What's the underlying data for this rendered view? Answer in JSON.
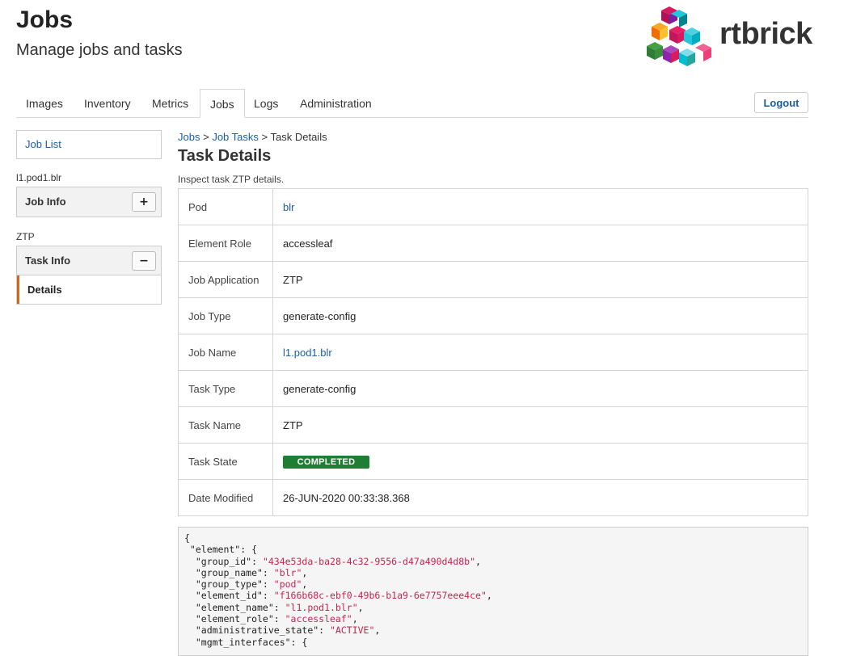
{
  "header": {
    "title": "Jobs",
    "subtitle": "Manage jobs and tasks"
  },
  "logo": {
    "text": "rtbrick"
  },
  "tabs": [
    {
      "label": "Images"
    },
    {
      "label": "Inventory"
    },
    {
      "label": "Metrics"
    },
    {
      "label": "Jobs",
      "active": true
    },
    {
      "label": "Logs"
    },
    {
      "label": "Administration"
    }
  ],
  "logout_label": "Logout",
  "sidebar": {
    "job_list": "Job List",
    "job_label": "l1.pod1.blr",
    "job_info": {
      "title": "Job Info",
      "toggle": "+"
    },
    "task_label": "ZTP",
    "task_info": {
      "title": "Task Info",
      "toggle": "−",
      "items": [
        "Details"
      ]
    }
  },
  "breadcrumb": {
    "jobs": "Jobs",
    "sep": ">",
    "job_tasks": "Job Tasks",
    "current": "Task Details"
  },
  "main": {
    "title": "Task Details",
    "description": "Inspect task ZTP details.",
    "rows": [
      {
        "label": "Pod",
        "value": "blr"
      },
      {
        "label": "Element Role",
        "value": "accessleaf"
      },
      {
        "label": "Job Application",
        "value": "ZTP"
      },
      {
        "label": "Job Type",
        "value": "generate-config"
      },
      {
        "label": "Job Name",
        "value": "l1.pod1.blr"
      },
      {
        "label": "Task Type",
        "value": "generate-config"
      },
      {
        "label": "Task Name",
        "value": "ZTP"
      },
      {
        "label": "Task State",
        "value": "COMPLETED"
      },
      {
        "label": "Date Modified",
        "value": "26-JUN-2020 00:33:38.368"
      }
    ]
  },
  "json_lines": [
    {
      "text": "{"
    },
    {
      "text": " \"element\": {"
    },
    {
      "text": "  \"group_id\": ",
      "str": "\"434e53da-ba28-4c32-9556-d47a490d4d8b\"",
      "after": ","
    },
    {
      "text": "  \"group_name\": ",
      "str": "\"blr\"",
      "after": ","
    },
    {
      "text": "  \"group_type\": ",
      "str": "\"pod\"",
      "after": ","
    },
    {
      "text": "  \"element_id\": ",
      "str": "\"f166b68c-ebf0-49b6-b1a9-6e7757eee4ce\"",
      "after": ","
    },
    {
      "text": "  \"element_name\": ",
      "str": "\"l1.pod1.blr\"",
      "after": ","
    },
    {
      "text": "  \"element_role\": ",
      "str": "\"accessleaf\"",
      "after": ","
    },
    {
      "text": "  \"administrative_state\": ",
      "str": "\"ACTIVE\"",
      "after": ","
    },
    {
      "text": "  \"mgmt_interfaces\": {"
    }
  ],
  "colors": {
    "accent": "#1a5ea8",
    "badge_completed": "#1e7e34",
    "active_item_bar": "#d2691e",
    "json_string": "#c7254e"
  }
}
